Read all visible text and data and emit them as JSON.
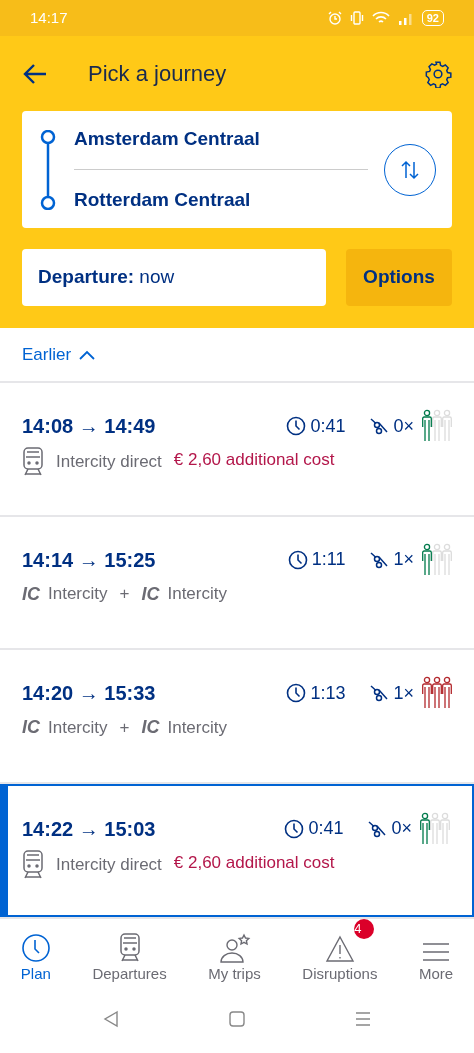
{
  "status_bar": {
    "time": "14:17",
    "battery": "92"
  },
  "header": {
    "title": "Pick a journey"
  },
  "route": {
    "from": "Amsterdam Centraal",
    "to": "Rotterdam Centraal"
  },
  "departure": {
    "label": "Departure:",
    "value": "now"
  },
  "options_button": "Options",
  "earlier_link": "Earlier",
  "journeys": [
    {
      "depart": "14:08",
      "arrow": "→",
      "arrive": "14:49",
      "duration": "0:41",
      "transfers": "0×",
      "crowding": [
        {
          "filled": true
        },
        {
          "filled": false
        },
        {
          "filled": false
        }
      ],
      "selected": false,
      "legs": [
        {
          "kind": "train",
          "label": "Intercity direct"
        }
      ],
      "surcharge": "€ 2,60 additional cost"
    },
    {
      "depart": "14:14",
      "arrow": "→",
      "arrive": "15:25",
      "duration": "1:11",
      "transfers": "1×",
      "crowding": [
        {
          "filled": true
        },
        {
          "filled": false
        },
        {
          "filled": false
        }
      ],
      "selected": false,
      "legs": [
        {
          "kind": "badge",
          "badge": "IC",
          "label": "Intercity"
        },
        {
          "kind": "badge",
          "joiner": "+",
          "badge": "IC",
          "label": "Intercity"
        }
      ]
    },
    {
      "depart": "14:20",
      "arrow": "→",
      "arrive": "15:33",
      "duration": "1:13",
      "transfers": "1×",
      "crowding": [
        {
          "filled": true
        },
        {
          "filled": true
        },
        {
          "filled": true
        }
      ],
      "selected": false,
      "legs": [
        {
          "kind": "badge",
          "badge": "IC",
          "label": "Intercity"
        },
        {
          "kind": "badge",
          "joiner": "+",
          "badge": "IC",
          "label": "Intercity"
        }
      ]
    },
    {
      "depart": "14:22",
      "arrow": "→",
      "arrive": "15:03",
      "duration": "0:41",
      "transfers": "0×",
      "crowding": [
        {
          "filled": true
        },
        {
          "filled": false
        },
        {
          "filled": false
        }
      ],
      "selected": true,
      "legs": [
        {
          "kind": "train",
          "label": "Intercity direct"
        }
      ],
      "surcharge": "€ 2,60 additional cost"
    }
  ],
  "nav": [
    {
      "kind": "plan",
      "label": "Plan",
      "selected": true
    },
    {
      "kind": "departures",
      "label": "Departures",
      "selected": false
    },
    {
      "kind": "trips",
      "label": "My trips",
      "selected": false
    },
    {
      "kind": "disruptions",
      "label": "Disruptions",
      "selected": false,
      "badge": "4"
    },
    {
      "kind": "more",
      "label": "More",
      "selected": false
    }
  ]
}
